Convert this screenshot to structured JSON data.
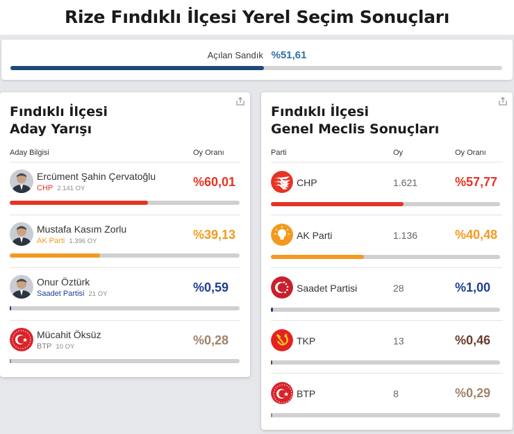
{
  "page_title": "Rize Fındıklı İlçesi Yerel Seçim Sonuçları",
  "opened": {
    "label": "Açılan Sandık",
    "value": "%51,61",
    "fraction": 0.5161,
    "bar_color": "#1e4a7a"
  },
  "left": {
    "title_line1": "Fındıklı İlçesi",
    "title_line2": "Aday Yarışı",
    "col_candidate": "Aday Bilgisi",
    "col_rate": "Oy Oranı",
    "candidates": [
      {
        "name": "Ercüment Şahin Çervatoğlu",
        "party": "CHP",
        "votes": "2.141 OY",
        "pct": "%60,01",
        "fraction": 0.6001,
        "color": "#e63323",
        "party_color": "#e63323",
        "avatar": "person-photo"
      },
      {
        "name": "Mustafa Kasım Zorlu",
        "party": "AK Parti",
        "votes": "1.396 OY",
        "pct": "%39,13",
        "fraction": 0.3913,
        "color": "#f39a1e",
        "party_color": "#f39a1e",
        "avatar": "person-photo"
      },
      {
        "name": "Onur Öztürk",
        "party": "Saadet Partisi",
        "votes": "21 OY",
        "pct": "%0,59",
        "fraction": 0.0059,
        "color": "#1c3e94",
        "party_color": "#1c3e94",
        "avatar": "person-photo"
      },
      {
        "name": "Mücahit Öksüz",
        "party": "BTP",
        "votes": "10 OY",
        "pct": "%0,28",
        "fraction": 0.0028,
        "color": "#a0826a",
        "party_color": "#8a7a6e",
        "avatar": "btp-logo"
      }
    ]
  },
  "right": {
    "title_line1": "Fındıklı İlçesi",
    "title_line2": "Genel Meclis Sonuçları",
    "col_party": "Parti",
    "col_votes": "Oy",
    "col_rate": "Oy Oranı",
    "parties": [
      {
        "name": "CHP",
        "votes": "1.621",
        "pct": "%57,77",
        "fraction": 0.5777,
        "color": "#e63323",
        "logo": "chp-logo"
      },
      {
        "name": "AK Parti",
        "votes": "1.136",
        "pct": "%40,48",
        "fraction": 0.4048,
        "color": "#f39a1e",
        "logo": "akparti-logo"
      },
      {
        "name": "Saadet Partisi",
        "votes": "28",
        "pct": "%1,00",
        "fraction": 0.01,
        "color": "#1c3e94",
        "logo": "saadet-logo"
      },
      {
        "name": "TKP",
        "votes": "13",
        "pct": "%0,46",
        "fraction": 0.0046,
        "color": "#6b3a2a",
        "logo": "tkp-logo"
      },
      {
        "name": "BTP",
        "votes": "8",
        "pct": "%0,29",
        "fraction": 0.0029,
        "color": "#a0826a",
        "logo": "btp-logo"
      }
    ]
  }
}
